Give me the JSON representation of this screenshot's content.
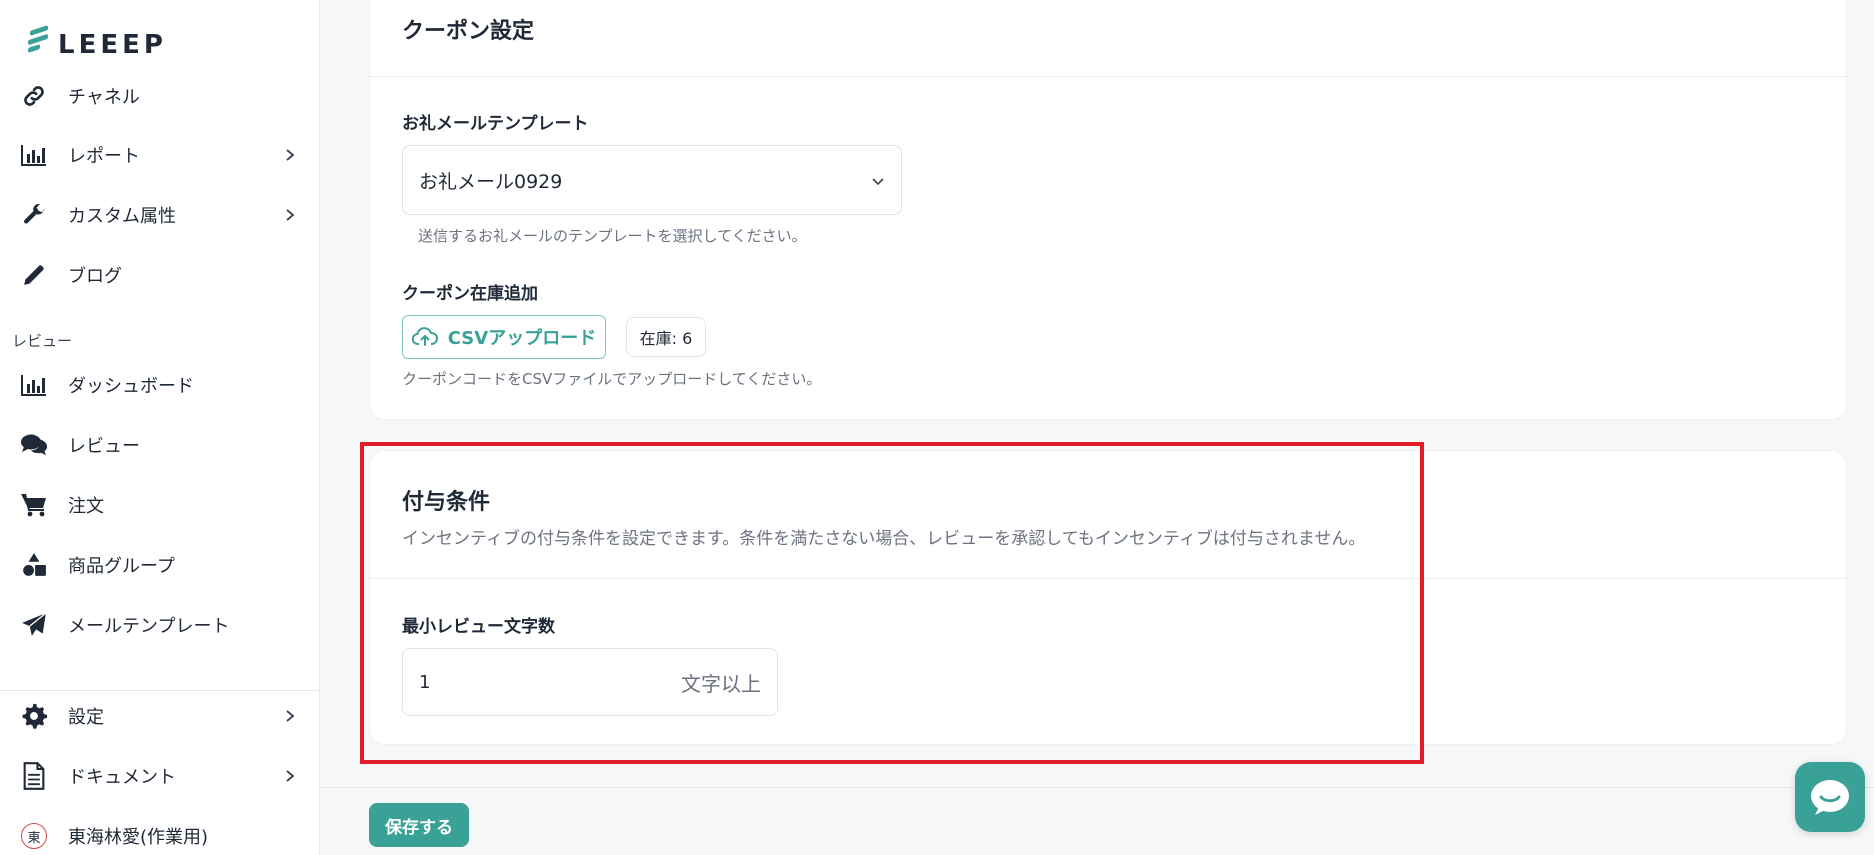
{
  "brand": {
    "logo_text": "LEEEP",
    "accent": "#3aa197"
  },
  "sidebar": {
    "top_items": [
      {
        "label": "チャネル",
        "icon": "link-icon"
      },
      {
        "label": "レポート",
        "icon": "bar-chart-icon",
        "has_chevron": true
      },
      {
        "label": "カスタム属性",
        "icon": "wrench-icon",
        "has_chevron": true
      },
      {
        "label": "ブログ",
        "icon": "pencil-icon"
      }
    ],
    "section_label": "レビュー",
    "review_items": [
      {
        "label": "ダッシュボード",
        "icon": "bar-chart-icon"
      },
      {
        "label": "レビュー",
        "icon": "chat-icon"
      },
      {
        "label": "注文",
        "icon": "cart-icon"
      },
      {
        "label": "商品グループ",
        "icon": "shapes-icon"
      },
      {
        "label": "メールテンプレート",
        "icon": "paper-plane-icon"
      }
    ],
    "bottom_items": [
      {
        "label": "設定",
        "icon": "gear-icon",
        "has_chevron": true
      },
      {
        "label": "ドキュメント",
        "icon": "document-icon",
        "has_chevron": true
      },
      {
        "label": "東海林愛(作業用)",
        "icon": "user-avatar-icon",
        "avatar_char": "東"
      }
    ]
  },
  "coupon_card": {
    "title": "クーポン設定",
    "template_label": "お礼メールテンプレート",
    "template_value": "お礼メール0929",
    "template_hint": "送信するお礼メールのテンプレートを選択してください。",
    "stock_label": "クーポン在庫追加",
    "csv_button": "CSVアップロード",
    "stock_badge": "在庫: 6",
    "csv_hint": "クーポンコードをCSVファイルでアップロードしてください。"
  },
  "condition_card": {
    "title": "付与条件",
    "description": "インセンティブの付与条件を設定できます。条件を満たさない場合、レビューを承認してもインセンティブは付与されません。",
    "min_chars_label": "最小レビュー文字数",
    "min_chars_value": "1",
    "min_chars_suffix": "文字以上"
  },
  "footer": {
    "save_label": "保存する"
  }
}
